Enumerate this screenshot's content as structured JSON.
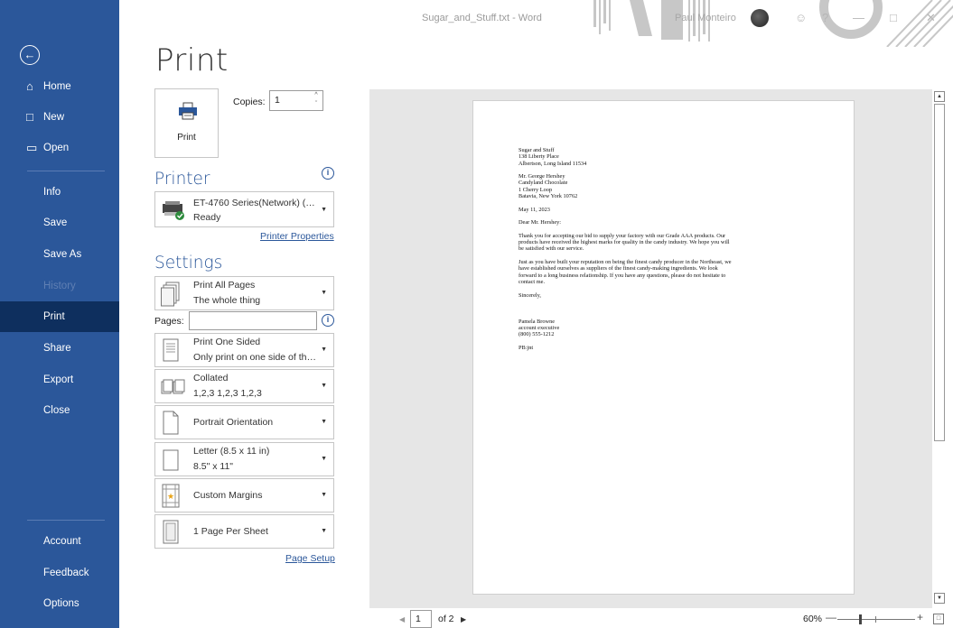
{
  "titlebar": {
    "doc_title": "Sugar_and_Stuff.txt  -  Word",
    "user_name": "Paul Monteiro"
  },
  "sidebar": {
    "items": [
      {
        "label": "Home",
        "icon": "home-icon"
      },
      {
        "label": "New",
        "icon": "new-document-icon"
      },
      {
        "label": "Open",
        "icon": "folder-open-icon"
      },
      {
        "label": "Info"
      },
      {
        "label": "Save"
      },
      {
        "label": "Save As"
      },
      {
        "label": "History"
      },
      {
        "label": "Print"
      },
      {
        "label": "Share"
      },
      {
        "label": "Export"
      },
      {
        "label": "Close"
      },
      {
        "label": "Account"
      },
      {
        "label": "Feedback"
      },
      {
        "label": "Options"
      }
    ]
  },
  "main": {
    "heading": "Print",
    "print_button_label": "Print",
    "copies_label": "Copies:",
    "copies_value": "1"
  },
  "printer": {
    "heading": "Printer",
    "name": "ET-4760 Series(Network) (Co...",
    "status": "Ready",
    "properties_link": "Printer Properties"
  },
  "settings": {
    "heading": "Settings",
    "print_range": {
      "line1": "Print All Pages",
      "line2": "The whole thing"
    },
    "pages_label": "Pages:",
    "pages_value": "",
    "sides": {
      "line1": "Print One Sided",
      "line2": "Only print on one side of the..."
    },
    "collation": {
      "line1": "Collated",
      "line2": "1,2,3   1,2,3   1,2,3"
    },
    "orientation": "Portrait Orientation",
    "paper": {
      "line1": "Letter (8.5 x 11 in)",
      "line2": "8.5\" x 11\""
    },
    "margins": "Custom Margins",
    "pages_per_sheet": "1 Page Per Sheet",
    "page_setup_link": "Page Setup"
  },
  "document": {
    "paragraphs": [
      "Sugar and Stuff\n138 Liberty Place\nAlbertson, Long Island  11534",
      "Mr. George Hershey\nCandyland Chocolate\n1 Cherry Loop\nBatavia, New York  10762",
      "May 11, 2023",
      "Dear Mr. Hershey:",
      "Thank you for accepting our bid to supply your factory with our Grade AAA products.  Our\nproducts have received the highest marks for quality in the candy industry.  We hope you will\nbe satisfied with our service.",
      "Just as you have built your reputation on being the finest candy producer in the Northeast, we\nhave established ourselves as suppliers of the finest candy-making ingredients.  We look\nforward to a long business relationship.  If you have any questions, please do not hesitate to\ncontact me.",
      "Sincerely,",
      "\n\nPamela Browne\naccount executive\n(800) 555-1212",
      "PB:jnt"
    ]
  },
  "preview_nav": {
    "current_page": "1",
    "of_pages": "of 2",
    "zoom": "60%"
  },
  "colors": {
    "sidebar": "#2b579a",
    "sidebar_active": "#0e2f5e",
    "accent": "#2b579a"
  }
}
